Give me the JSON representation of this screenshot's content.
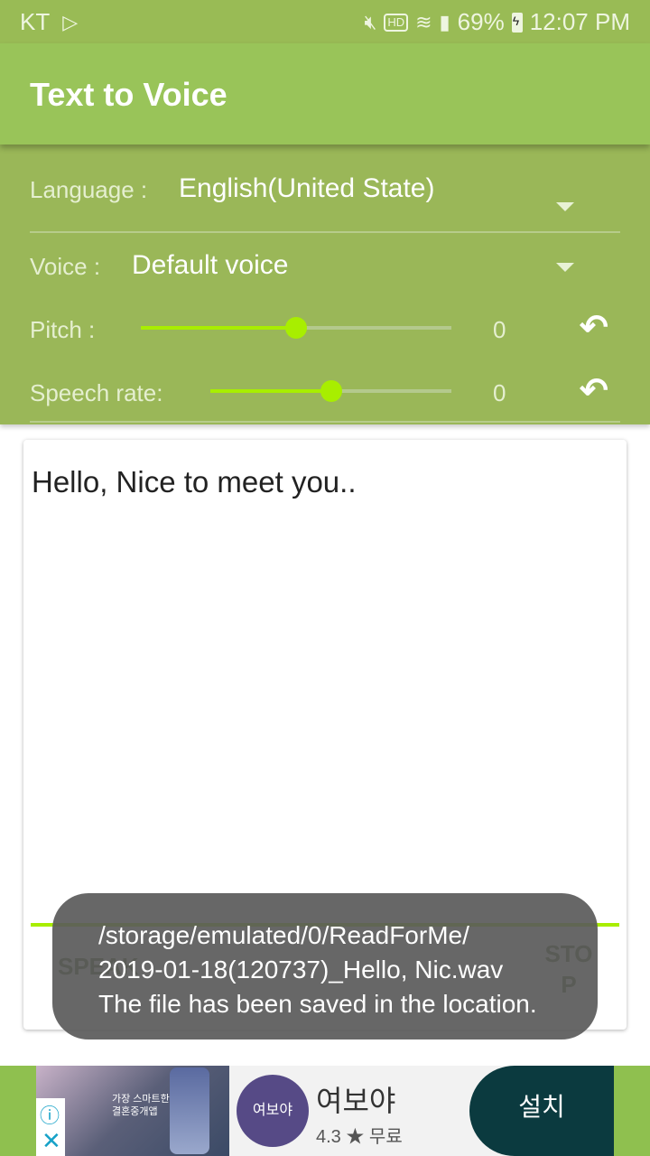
{
  "status_bar": {
    "carrier": "KT",
    "battery": "69%",
    "time": "12:07 PM",
    "icons": [
      "play-store-icon",
      "mute-icon",
      "hd-voice-icon",
      "wifi-icon",
      "signal-icon",
      "battery-charging-icon"
    ],
    "hd_label": "HD"
  },
  "app_bar": {
    "title": "Text to Voice"
  },
  "settings": {
    "language": {
      "label": "Language :",
      "value": "English(United State)"
    },
    "voice": {
      "label": "Voice :",
      "value": "Default voice"
    },
    "pitch": {
      "label": "Pitch :",
      "value": "0",
      "slider_fraction": 0.5
    },
    "speech_rate": {
      "label": "Speech rate:",
      "value": "0",
      "slider_fraction": 0.5
    }
  },
  "editor": {
    "text": "Hello, Nice to meet you.."
  },
  "buttons": {
    "speak": "SPEAK",
    "stop": "STOP"
  },
  "toast": {
    "line1": "/storage/emulated/0/ReadForMe/",
    "line2": "2019-01-18(120737)_Hello, Nic.wav",
    "line3": "The file has been saved in the location."
  },
  "ad": {
    "banner_text_1": "가장 스마트한",
    "banner_text_2": "결혼중개앱",
    "app_icon_text": "여보야",
    "app_name": "여보야",
    "rating": "4.3 ★ 무료",
    "install_label": "설치",
    "info_glyph": "ⓘ",
    "close_glyph": "✕"
  },
  "colors": {
    "status_bar": "#99bb55",
    "app_bar": "#99c459",
    "settings_panel": "#9ab758",
    "accent": "#a8ee00",
    "toast": "#5a5a5a",
    "install_button": "#0b3a3f"
  }
}
